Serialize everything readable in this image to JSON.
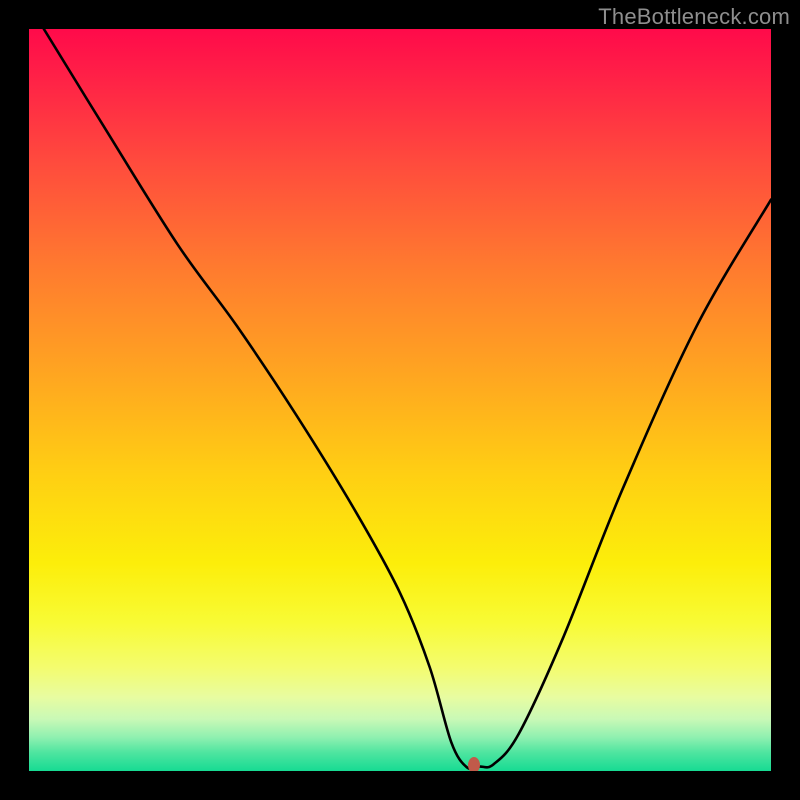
{
  "watermark": "TheBottleneck.com",
  "colors": {
    "frame": "#000000",
    "curve": "#000000",
    "marker": "#c15a4a",
    "gradient_top": "#ff0a4a",
    "gradient_bottom": "#16db93"
  },
  "chart_data": {
    "type": "line",
    "title": "",
    "xlabel": "",
    "ylabel": "",
    "xlim": [
      0,
      100
    ],
    "ylim": [
      0,
      100
    ],
    "series": [
      {
        "name": "bottleneck-curve",
        "x": [
          2,
          10,
          20,
          28,
          36,
          44,
          50,
          54,
          56.9,
          59.0,
          60.7,
          62.6,
          66,
          72,
          80,
          90,
          100
        ],
        "values": [
          100,
          87,
          71,
          60,
          48,
          35,
          24,
          14,
          3.9,
          0.5,
          0.6,
          0.9,
          5,
          18,
          38,
          60,
          77
        ]
      }
    ],
    "marker": {
      "x": 60,
      "y": 0.8,
      "name": "optimal-point"
    }
  }
}
